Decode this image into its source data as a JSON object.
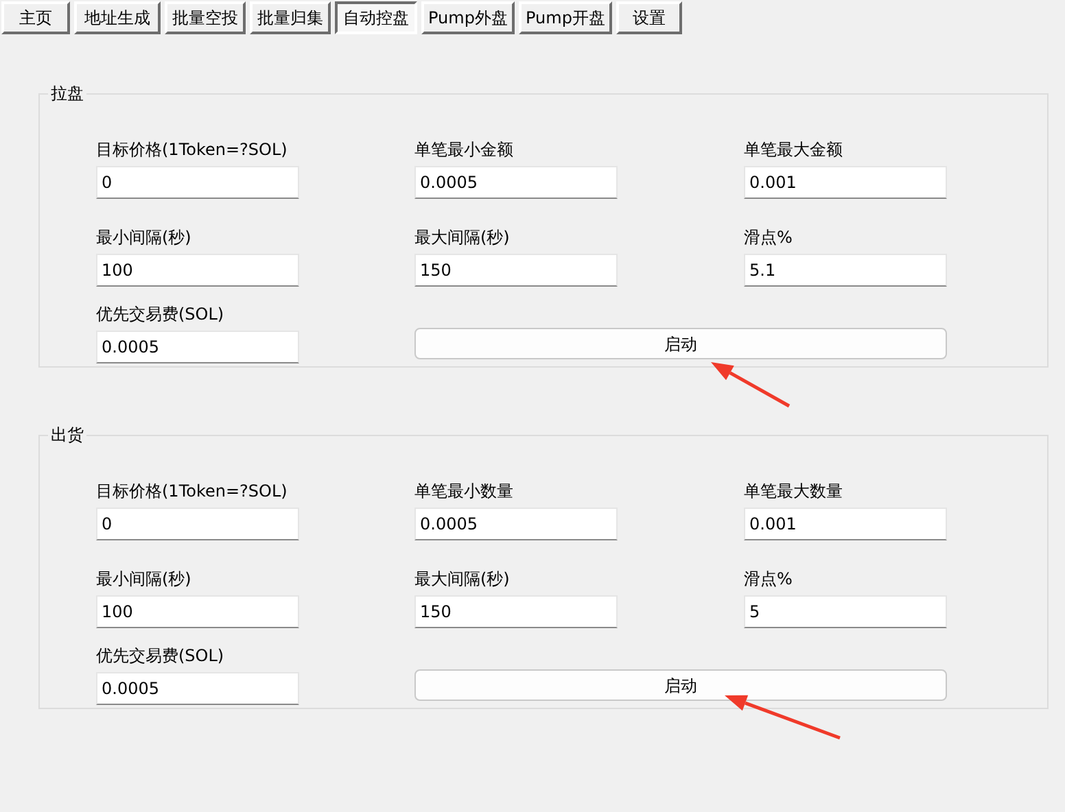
{
  "tabs": [
    {
      "label": "主页",
      "selected": false
    },
    {
      "label": "地址生成",
      "selected": false
    },
    {
      "label": "批量空投",
      "selected": false
    },
    {
      "label": "批量归集",
      "selected": false
    },
    {
      "label": "自动控盘",
      "selected": true
    },
    {
      "label": "Pump外盘",
      "selected": false
    },
    {
      "label": "Pump开盘",
      "selected": false
    },
    {
      "label": "设置",
      "selected": false
    }
  ],
  "groups": [
    {
      "title": "拉盘",
      "rows": [
        [
          {
            "kind": "field",
            "label": "目标价格(1Token=?SOL)",
            "value": "0"
          },
          {
            "kind": "field",
            "label": "单笔最小金额",
            "value": "0.0005"
          },
          {
            "kind": "field",
            "label": "单笔最大金额",
            "value": "0.001"
          }
        ],
        [
          {
            "kind": "field",
            "label": "最小间隔(秒)",
            "value": "100"
          },
          {
            "kind": "field",
            "label": "最大间隔(秒)",
            "value": "150"
          },
          {
            "kind": "field",
            "label": "滑点%",
            "value": "5.1"
          }
        ],
        [
          {
            "kind": "field",
            "label": "优先交易费(SOL)",
            "value": "0.0005"
          },
          {
            "kind": "button",
            "label": "启动"
          }
        ]
      ]
    },
    {
      "title": "出货",
      "rows": [
        [
          {
            "kind": "field",
            "label": "目标价格(1Token=?SOL)",
            "value": "0"
          },
          {
            "kind": "field",
            "label": "单笔最小数量",
            "value": "0.0005"
          },
          {
            "kind": "field",
            "label": "单笔最大数量",
            "value": "0.001"
          }
        ],
        [
          {
            "kind": "field",
            "label": "最小间隔(秒)",
            "value": "100"
          },
          {
            "kind": "field",
            "label": "最大间隔(秒)",
            "value": "150"
          },
          {
            "kind": "field",
            "label": "滑点%",
            "value": "5"
          }
        ],
        [
          {
            "kind": "field",
            "label": "优先交易费(SOL)",
            "value": "0.0005"
          },
          {
            "kind": "button",
            "label": "启动"
          }
        ]
      ]
    }
  ]
}
